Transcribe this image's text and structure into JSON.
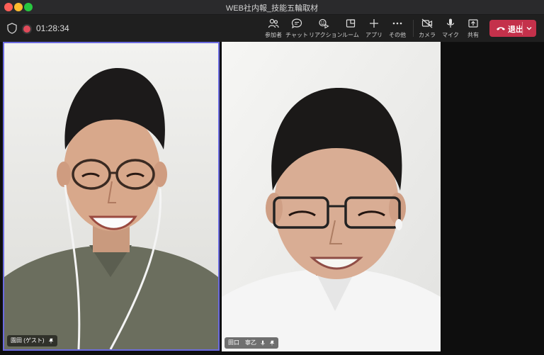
{
  "window": {
    "title": "WEB社内報_技能五輪取材"
  },
  "meeting": {
    "timer": "01:28:34"
  },
  "toolbar": {
    "buttons": [
      {
        "label": "参加者",
        "icon": "people-icon"
      },
      {
        "label": "チャット",
        "icon": "chat-icon"
      },
      {
        "label": "リアクション",
        "icon": "reaction-icon"
      },
      {
        "label": "ルーム",
        "icon": "room-icon"
      },
      {
        "label": "アプリ",
        "icon": "plus-icon"
      },
      {
        "label": "その他",
        "icon": "more-icon"
      },
      {
        "label": "カメラ",
        "icon": "camera-icon"
      },
      {
        "label": "マイク",
        "icon": "mic-icon"
      },
      {
        "label": "共有",
        "icon": "share-icon"
      }
    ],
    "leave_label": "退出"
  },
  "participants": [
    {
      "name": "園田 (ゲスト)"
    },
    {
      "name": "田口　寧乙"
    }
  ],
  "colors": {
    "leave": "#c4314b",
    "active_border": "#6b6be0",
    "record": "#e14b5a"
  }
}
